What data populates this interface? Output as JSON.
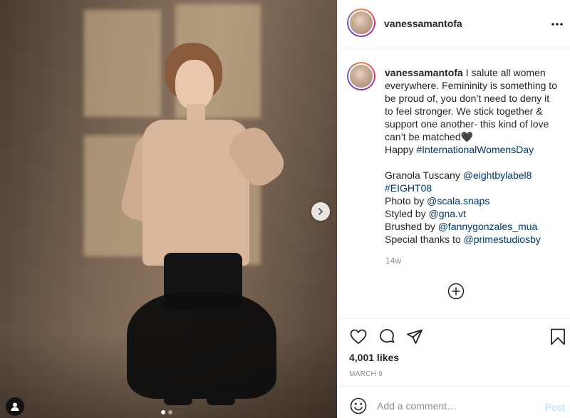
{
  "post": {
    "username": "vanessamantofa",
    "more_icon": "more-horizontal-icon",
    "caption": {
      "username": "vanessamantofa",
      "line1_text": " I salute all women everywhere. Femininity is something to be proud of, you don’t need to deny it to feel stronger. We stick together & support one another- this kind of love can’t be matched🖤",
      "line2_prefix": "Happy ",
      "hashtag_iwd": "#InternationalWomensDay",
      "credit1_prefix": "Granola Tuscany ",
      "mention1": "@eightbylabel8",
      "hashtag_eight": "#EIGHT08",
      "credit2_prefix": "Photo by ",
      "mention2": "@scala.snaps",
      "credit3_prefix": "Styled by ",
      "mention3": "@gna.vt",
      "credit4_prefix": "Brushed by ",
      "mention4": "@fannygonzales_mua",
      "credit5_prefix": "Special thanks to ",
      "mention5": "@primestudiosby"
    },
    "time_ago": "14w",
    "likes": "4,001 likes",
    "date": "MARCH 9",
    "comment_placeholder": "Add a comment…",
    "post_label": "Post",
    "carousel": {
      "total": 2,
      "current": 1
    }
  },
  "icons": {
    "like": "heart-icon",
    "comment": "comment-icon",
    "share": "share-icon",
    "save": "bookmark-icon",
    "load_more": "plus-circle-icon",
    "emoji": "emoji-icon",
    "next": "chevron-right-icon",
    "tag": "user-tag-icon"
  },
  "colors": {
    "link": "#00376b",
    "post_button": "#b2dffc",
    "muted": "#8e8e8e"
  }
}
